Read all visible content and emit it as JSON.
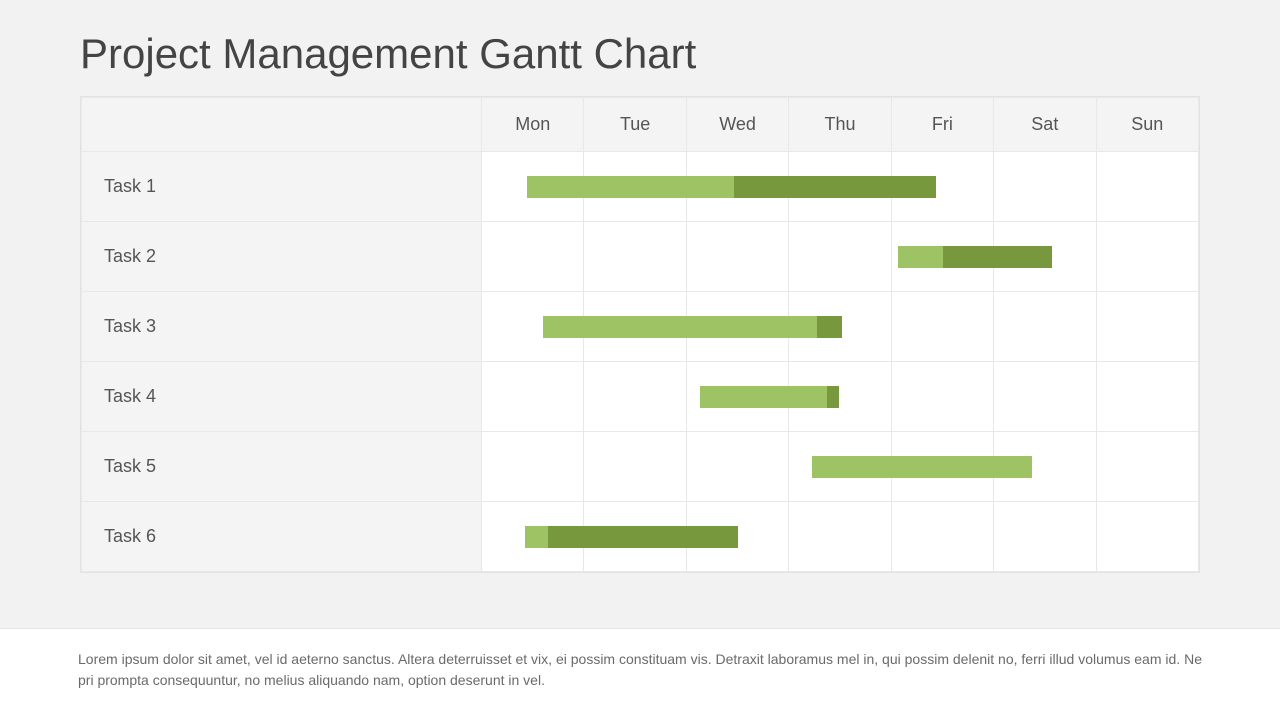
{
  "title": "Project Management Gantt Chart",
  "footer_text": "Lorem ipsum dolor sit amet, vel id aeterno sanctus. Altera deterruisset et vix, ei possim constituam vis. Detraxit laboramus mel in, qui possim delenit no, ferri illud volumus eam id. Ne pri prompta consequuntur, no melius aliquando nam, option deserunt in vel.",
  "colors": {
    "light": "#9ec365",
    "dark": "#78983e"
  },
  "chart_data": {
    "type": "gantt",
    "title": "Project Management Gantt Chart",
    "x_categories": [
      "Mon",
      "Tue",
      "Wed",
      "Thu",
      "Fri",
      "Sat",
      "Sun"
    ],
    "xlim": [
      0,
      7
    ],
    "tasks": [
      {
        "name": "Task 1",
        "start": 0.44,
        "end_light": 2.48,
        "end": 4.48
      },
      {
        "name": "Task 2",
        "start": 4.1,
        "end_light": 4.55,
        "end": 5.62
      },
      {
        "name": "Task 3",
        "start": 0.6,
        "end_light": 3.3,
        "end": 3.55
      },
      {
        "name": "Task 4",
        "start": 2.15,
        "end_light": 3.4,
        "end": 3.52
      },
      {
        "name": "Task 5",
        "start": 3.25,
        "end_light": 5.42,
        "end": 5.42
      },
      {
        "name": "Task 6",
        "start": 0.42,
        "end_light": 0.65,
        "end": 2.52
      }
    ]
  }
}
